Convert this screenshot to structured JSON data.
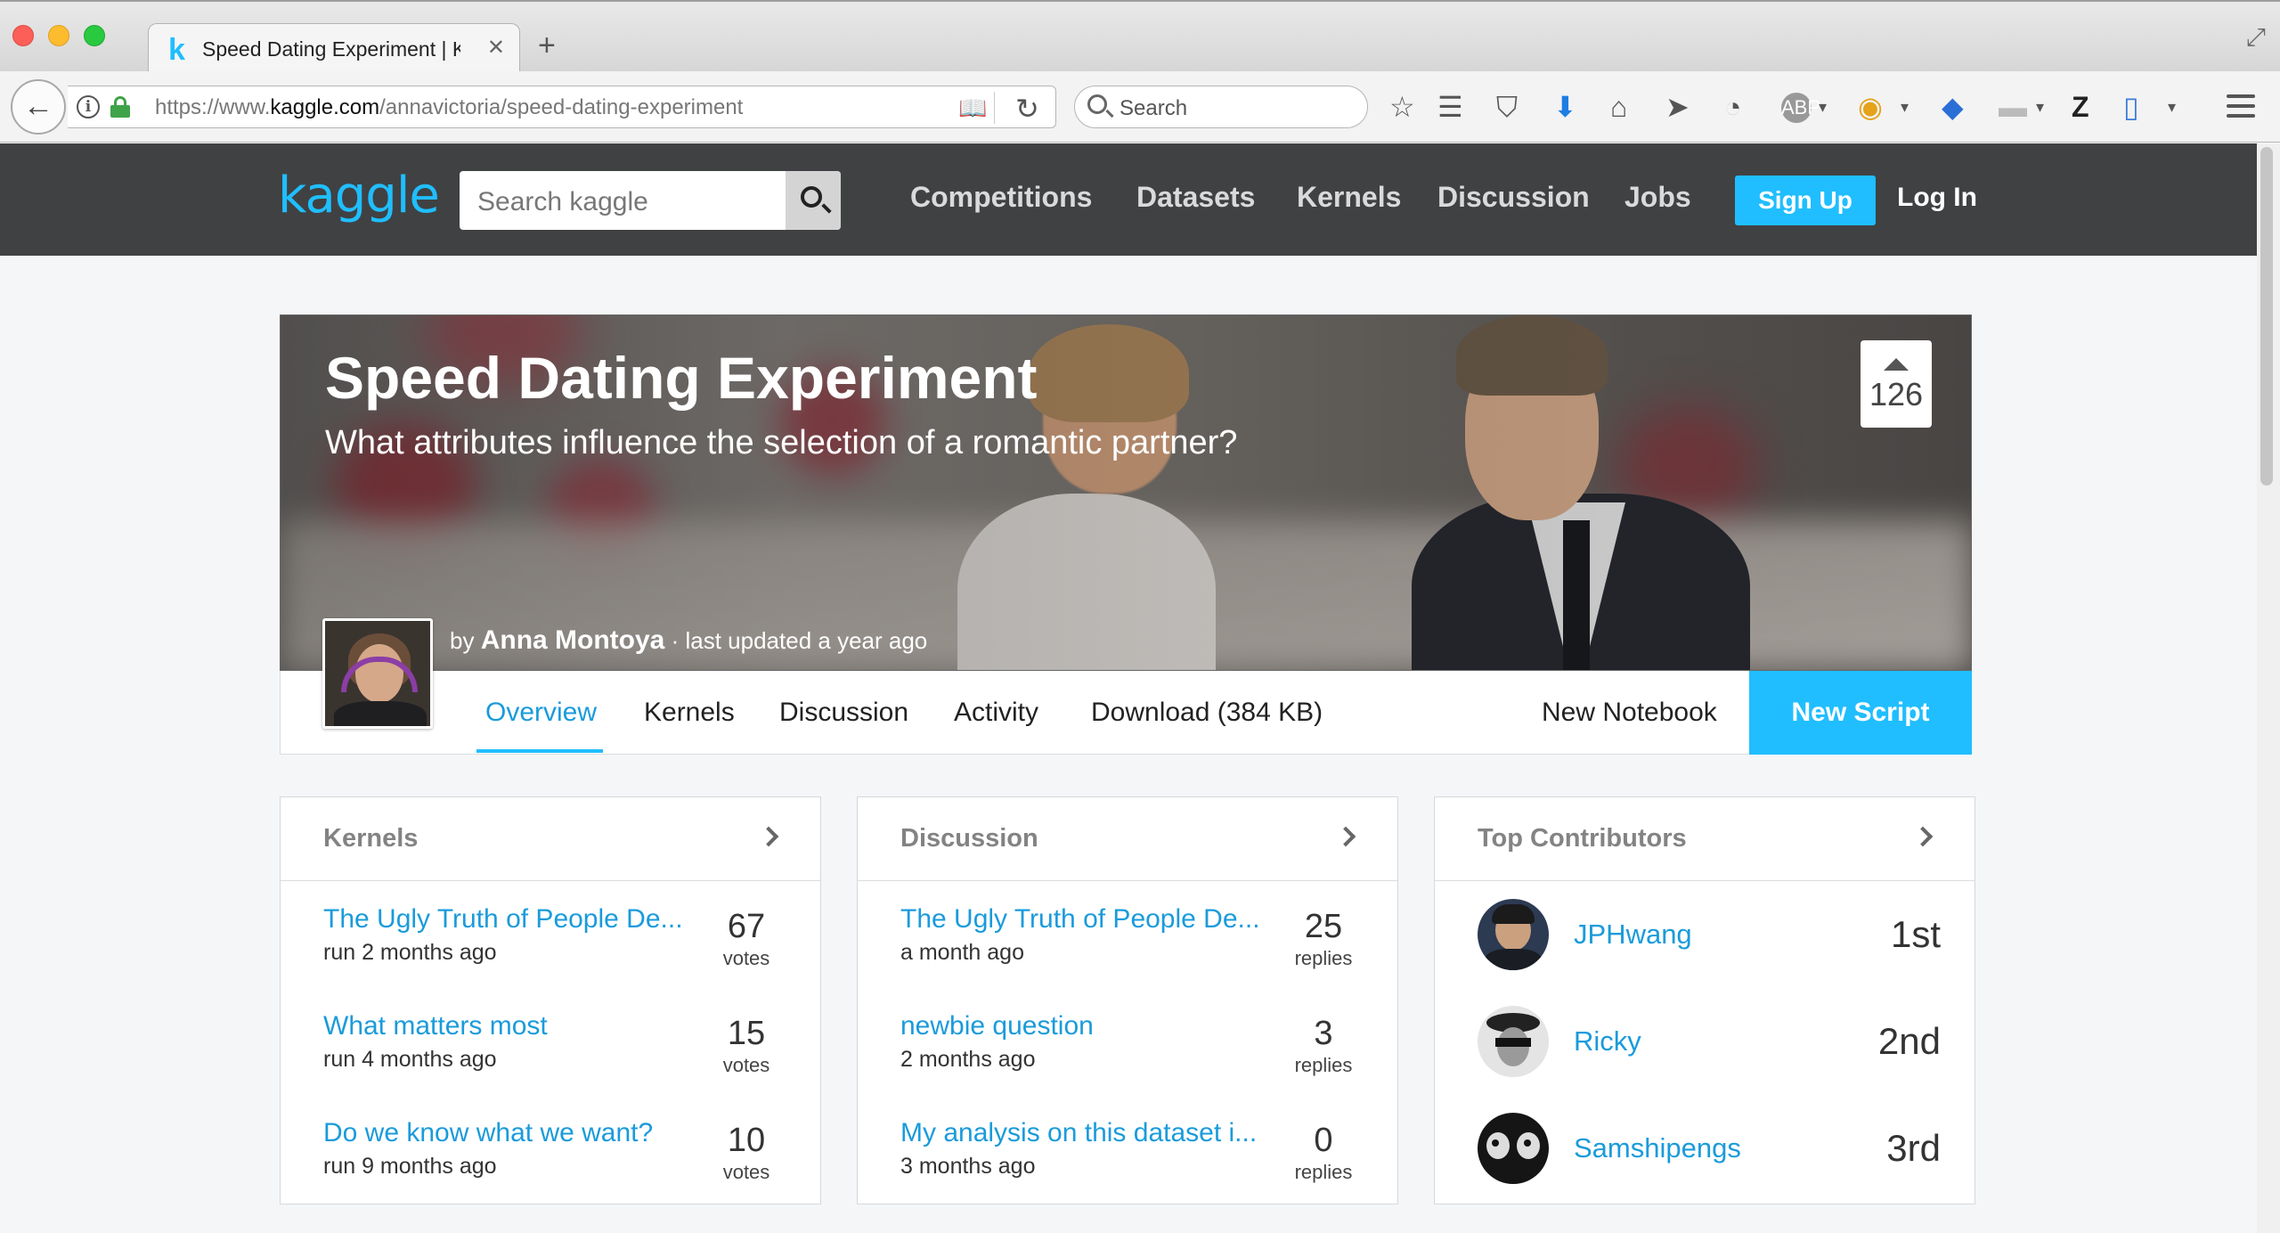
{
  "browser": {
    "tab_title": "Speed Dating Experiment | K",
    "tab_favicon": "k",
    "url_prefix": "https://www.",
    "url_domain": "kaggle.com",
    "url_path": "/annavictoria/speed-dating-experiment",
    "search_placeholder": "Search"
  },
  "kaggle": {
    "logo": "kaggle",
    "search_placeholder": "Search kaggle",
    "nav": [
      "Competitions",
      "Datasets",
      "Kernels",
      "Discussion",
      "Jobs"
    ],
    "signup": "Sign Up",
    "login": "Log In"
  },
  "dataset": {
    "title": "Speed Dating Experiment",
    "subtitle": "What attributes influence the selection of a romantic partner?",
    "votes": "126",
    "by": "by",
    "author": "Anna Montoya",
    "updated": "· last updated a year ago",
    "tabs": [
      "Overview",
      "Kernels",
      "Discussion",
      "Activity",
      "Download (384 KB)"
    ],
    "active_tab": "Overview",
    "new_notebook": "New Notebook",
    "new_script": "New Script"
  },
  "kernels_card": {
    "title": "Kernels",
    "items": [
      {
        "title": "The Ugly Truth of People De...",
        "sub": "run 2 months ago",
        "num": "67",
        "unit": "votes"
      },
      {
        "title": "What matters most",
        "sub": "run 4 months ago",
        "num": "15",
        "unit": "votes"
      },
      {
        "title": "Do we know what we want?",
        "sub": "run 9 months ago",
        "num": "10",
        "unit": "votes"
      }
    ]
  },
  "discussion_card": {
    "title": "Discussion",
    "items": [
      {
        "title": "The Ugly Truth of People De...",
        "sub": "a month ago",
        "num": "25",
        "unit": "replies"
      },
      {
        "title": "newbie question",
        "sub": "2 months ago",
        "num": "3",
        "unit": "replies"
      },
      {
        "title": "My analysis on this dataset i...",
        "sub": "3 months ago",
        "num": "0",
        "unit": "replies"
      }
    ]
  },
  "contributors_card": {
    "title": "Top Contributors",
    "items": [
      {
        "name": "JPHwang",
        "rank": "1st"
      },
      {
        "name": "Ricky",
        "rank": "2nd"
      },
      {
        "name": "Samshipengs",
        "rank": "3rd"
      }
    ]
  },
  "colors": {
    "accent": "#20beff",
    "link": "#1a9bdb",
    "header_bg": "#404143"
  }
}
